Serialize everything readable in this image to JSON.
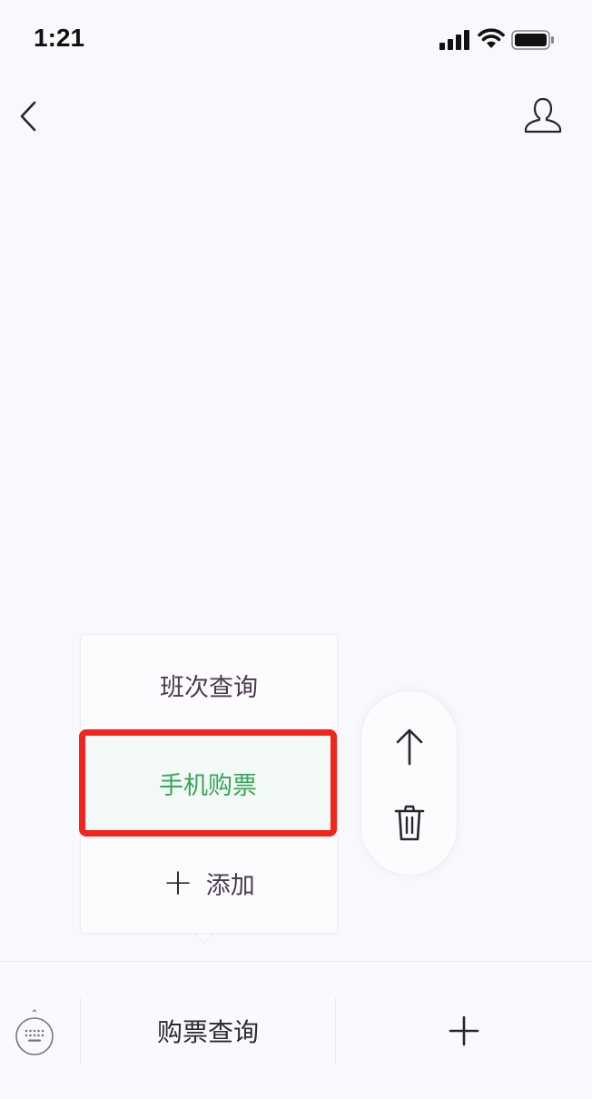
{
  "status_bar": {
    "time": "1:21"
  },
  "icons": {
    "back": "chevron-left-icon",
    "profile": "user-icon",
    "move_up": "arrow-up-icon",
    "delete": "trash-icon",
    "keyboard": "keyboard-icon",
    "add": "plus-icon"
  },
  "popup_menu": {
    "items": [
      {
        "label": "班次查询"
      },
      {
        "label": "手机购票",
        "highlighted": true
      },
      {
        "label": "添加",
        "prefix": "+"
      }
    ]
  },
  "bottom_bar": {
    "menu_label": "购票查询"
  },
  "colors": {
    "highlight_border": "#f2251c",
    "highlight_text": "#39a55a",
    "highlight_bg": "#f2f9f7",
    "background": "#f8f9fd"
  }
}
